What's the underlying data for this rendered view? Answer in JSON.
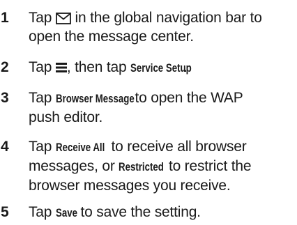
{
  "steps": [
    {
      "number": "1",
      "line1_a": "Tap",
      "icon": "envelope-icon",
      "line1_b": "in the global navigation bar to",
      "line2": "open the message center."
    },
    {
      "number": "2",
      "a": "Tap",
      "icon": "menu-icon",
      "b": ", then tap",
      "kw1": "Service Setup",
      "c": "."
    },
    {
      "number": "3",
      "a": "Tap",
      "kw1": "Browser Message",
      "b": "to open the WAP",
      "line2": "push editor."
    },
    {
      "number": "4",
      "a": "Tap",
      "kw1": "Receive All",
      "b": "to receive all browser",
      "line2_a": "messages, or",
      "kw2": "Restricted",
      "line2_b": "to restrict the",
      "line3": "browser messages you receive."
    },
    {
      "number": "5",
      "a": "Tap",
      "kw1": "Save",
      "b": "to save the setting."
    }
  ]
}
